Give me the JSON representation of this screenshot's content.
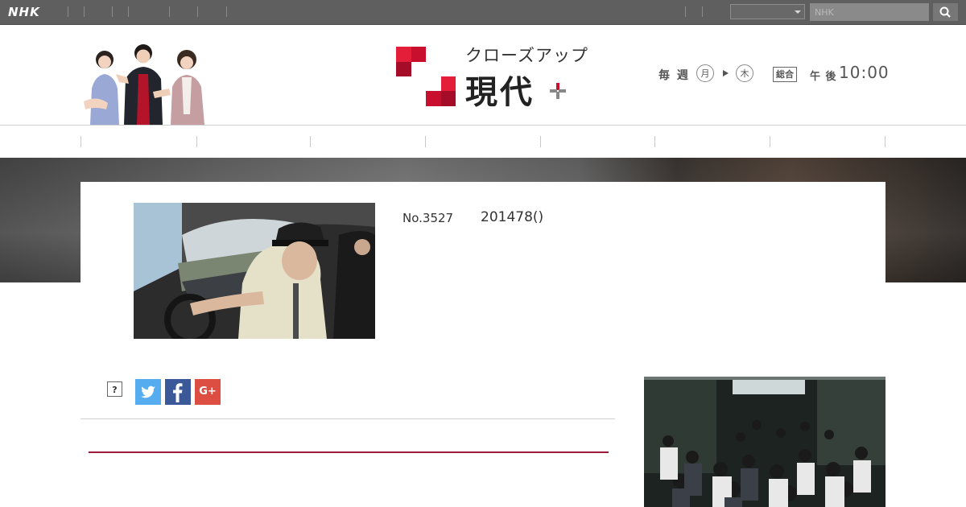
{
  "topbar": {
    "logo": "NHK",
    "region_select_value": "",
    "search_placeholder": "NHK",
    "search_icon": "search-icon",
    "background": "#5f5f5f"
  },
  "header": {
    "logo_kana": "クローズアップ",
    "logo_kanji": "現代",
    "schedule": {
      "weekly": "毎 週",
      "day_start": "月",
      "day_end": "木",
      "channel": "総合",
      "ampm": "午 後",
      "time": "10:00"
    }
  },
  "episode": {
    "number": "No.3527",
    "date": "201478()"
  },
  "share": {
    "help_label": "?",
    "twitter_icon": "twitter-icon",
    "facebook_icon": "facebook-icon",
    "gplus_label": "G+"
  },
  "colors": {
    "accent_red": "#9c1b3c",
    "logo_red": "#c8102e",
    "twitter": "#55acee",
    "facebook": "#3b5998",
    "gplus": "#dc4e41"
  }
}
